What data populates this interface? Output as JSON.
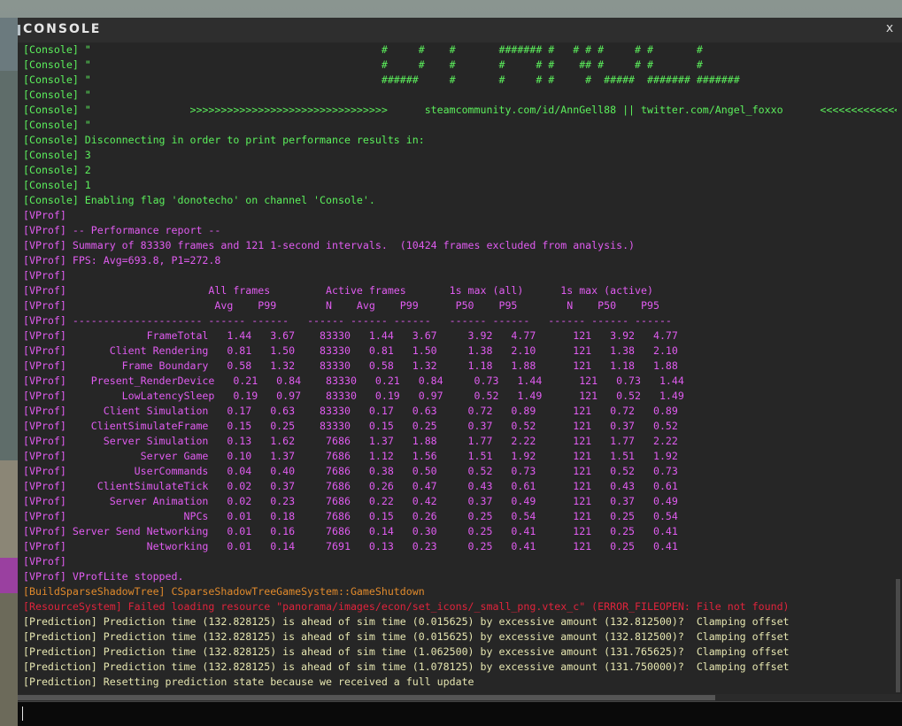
{
  "window": {
    "title": "CONSOLE",
    "close_label": "x"
  },
  "colors": {
    "console": "#5cf05c",
    "vprof": "#e05cf0",
    "shadowtree": "#e08a2c",
    "resource_error": "#e0243c",
    "prediction": "#e6e6b0"
  },
  "lines": [
    {
      "color": "console",
      "text": "[Console] \"                                               #     #    #       ####### #   # # #     # #       #"
    },
    {
      "color": "console",
      "text": "[Console] \"                                               #     #    #       #     # #    ## #     # #       #"
    },
    {
      "color": "console",
      "text": "[Console] \"                                               ######     #       #     # #     #  #####  ####### #######"
    },
    {
      "color": "console",
      "text": "[Console] \""
    },
    {
      "color": "console",
      "text": "[Console] \"                >>>>>>>>>>>>>>>>>>>>>>>>>>>>>>>>      steamcommunity.com/id/AnnGell88 || twitter.com/Angel_foxxo      <<<<<<<<<<<<<<<<"
    },
    {
      "color": "console",
      "text": "[Console] \""
    },
    {
      "color": "console",
      "text": "[Console] Disconnecting in order to print performance results in:"
    },
    {
      "color": "console",
      "text": "[Console] 3"
    },
    {
      "color": "console",
      "text": "[Console] 2"
    },
    {
      "color": "console",
      "text": "[Console] 1"
    },
    {
      "color": "console",
      "text": "[Console] Enabling flag 'donotecho' on channel 'Console'."
    },
    {
      "color": "vprof",
      "text": "[VProf]"
    },
    {
      "color": "vprof",
      "text": "[VProf] -- Performance report --"
    },
    {
      "color": "vprof",
      "text": "[VProf] Summary of 83330 frames and 121 1-second intervals.  (10424 frames excluded from analysis.)"
    },
    {
      "color": "vprof",
      "text": "[VProf] FPS: Avg=693.8, P1=272.8"
    },
    {
      "color": "vprof",
      "text": "[VProf]"
    },
    {
      "color": "vprof",
      "text": "[VProf]                       All frames         Active frames       1s max (all)      1s max (active)"
    },
    {
      "color": "vprof",
      "text": "[VProf]                        Avg    P99        N    Avg    P99      P50    P95        N    P50    P95"
    },
    {
      "color": "vprof",
      "text": "[VProf] --------------------- ------ ------   ------ ------ ------   ------ ------   ------ ------ ------"
    },
    {
      "color": "vprof",
      "text": "[VProf]             FrameTotal   1.44   3.67    83330   1.44   3.67     3.92   4.77      121   3.92   4.77"
    },
    {
      "color": "vprof",
      "text": "[VProf]       Client Rendering   0.81   1.50    83330   0.81   1.50     1.38   2.10      121   1.38   2.10"
    },
    {
      "color": "vprof",
      "text": "[VProf]         Frame Boundary   0.58   1.32    83330   0.58   1.32     1.18   1.88      121   1.18   1.88"
    },
    {
      "color": "vprof",
      "text": "[VProf]    Present_RenderDevice   0.21   0.84    83330   0.21   0.84     0.73   1.44      121   0.73   1.44"
    },
    {
      "color": "vprof",
      "text": "[VProf]         LowLatencySleep   0.19   0.97    83330   0.19   0.97     0.52   1.49      121   0.52   1.49"
    },
    {
      "color": "vprof",
      "text": "[VProf]      Client Simulation   0.17   0.63    83330   0.17   0.63     0.72   0.89      121   0.72   0.89"
    },
    {
      "color": "vprof",
      "text": "[VProf]    ClientSimulateFrame   0.15   0.25    83330   0.15   0.25     0.37   0.52      121   0.37   0.52"
    },
    {
      "color": "vprof",
      "text": "[VProf]      Server Simulation   0.13   1.62     7686   1.37   1.88     1.77   2.22      121   1.77   2.22"
    },
    {
      "color": "vprof",
      "text": "[VProf]            Server Game   0.10   1.37     7686   1.12   1.56     1.51   1.92      121   1.51   1.92"
    },
    {
      "color": "vprof",
      "text": "[VProf]           UserCommands   0.04   0.40     7686   0.38   0.50     0.52   0.73      121   0.52   0.73"
    },
    {
      "color": "vprof",
      "text": "[VProf]     ClientSimulateTick   0.02   0.37     7686   0.26   0.47     0.43   0.61      121   0.43   0.61"
    },
    {
      "color": "vprof",
      "text": "[VProf]       Server Animation   0.02   0.23     7686   0.22   0.42     0.37   0.49      121   0.37   0.49"
    },
    {
      "color": "vprof",
      "text": "[VProf]                   NPCs   0.01   0.18     7686   0.15   0.26     0.25   0.54      121   0.25   0.54"
    },
    {
      "color": "vprof",
      "text": "[VProf] Server Send Networking   0.01   0.16     7686   0.14   0.30     0.25   0.41      121   0.25   0.41"
    },
    {
      "color": "vprof",
      "text": "[VProf]             Networking   0.01   0.14     7691   0.13   0.23     0.25   0.41      121   0.25   0.41"
    },
    {
      "color": "vprof",
      "text": "[VProf]"
    },
    {
      "color": "vprof",
      "text": "[VProf] VProfLite stopped."
    },
    {
      "color": "shadowtree",
      "text": "[BuildSparseShadowTree] CSparseShadowTreeGameSystem::GameShutdown"
    },
    {
      "color": "resource_error",
      "text": "[ResourceSystem] Failed loading resource \"panorama/images/econ/set_icons/_small_png.vtex_c\" (ERROR_FILEOPEN: File not found)"
    },
    {
      "color": "prediction",
      "text": "[Prediction] Prediction time (132.828125) is ahead of sim time (0.015625) by excessive amount (132.812500)?  Clamping offset"
    },
    {
      "color": "prediction",
      "text": "[Prediction] Prediction time (132.828125) is ahead of sim time (0.015625) by excessive amount (132.812500)?  Clamping offset"
    },
    {
      "color": "prediction",
      "text": "[Prediction] Prediction time (132.828125) is ahead of sim time (1.062500) by excessive amount (131.765625)?  Clamping offset"
    },
    {
      "color": "prediction",
      "text": "[Prediction] Prediction time (132.828125) is ahead of sim time (1.078125) by excessive amount (131.750000)?  Clamping offset"
    },
    {
      "color": "prediction",
      "text": "[Prediction] Resetting prediction state because we received a full update"
    }
  ],
  "input": {
    "value": "",
    "placeholder": ""
  }
}
